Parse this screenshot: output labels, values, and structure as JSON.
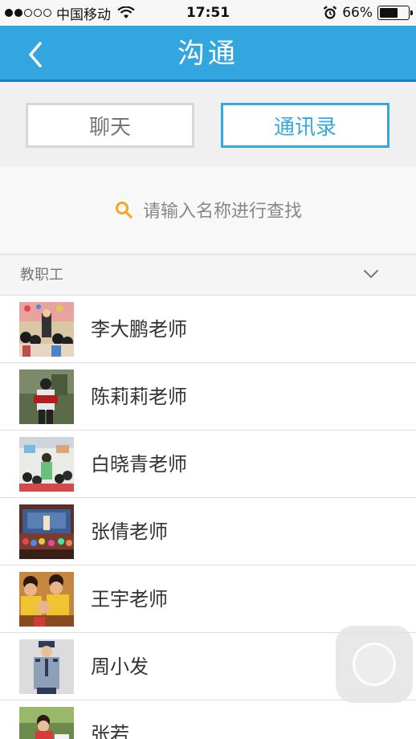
{
  "status_bar": {
    "carrier": "中国移动",
    "time": "17:51",
    "battery_text": "66%",
    "battery_level": 0.66,
    "signal_bars_filled": 2,
    "signal_bars_total": 5
  },
  "nav": {
    "title": "沟通",
    "back_icon": "chevron-left-icon"
  },
  "tabs": [
    {
      "label": "聊天",
      "selected": false
    },
    {
      "label": "通讯录",
      "selected": true
    }
  ],
  "search": {
    "placeholder": "请输入名称进行查找",
    "icon": "search-icon"
  },
  "group": {
    "label": "教职工",
    "icon": "chevron-down-icon"
  },
  "contacts": [
    {
      "name": "李大鹏老师"
    },
    {
      "name": "陈莉莉老师"
    },
    {
      "name": "白晓青老师"
    },
    {
      "name": "张倩老师"
    },
    {
      "name": "王宇老师"
    },
    {
      "name": "周小发"
    },
    {
      "name": "张若"
    }
  ],
  "colors": {
    "accent": "#33a6e0",
    "accent_dark": "#1d7fbd",
    "search_icon": "#f5a623",
    "tab_inactive_border": "#d6d6d6"
  }
}
